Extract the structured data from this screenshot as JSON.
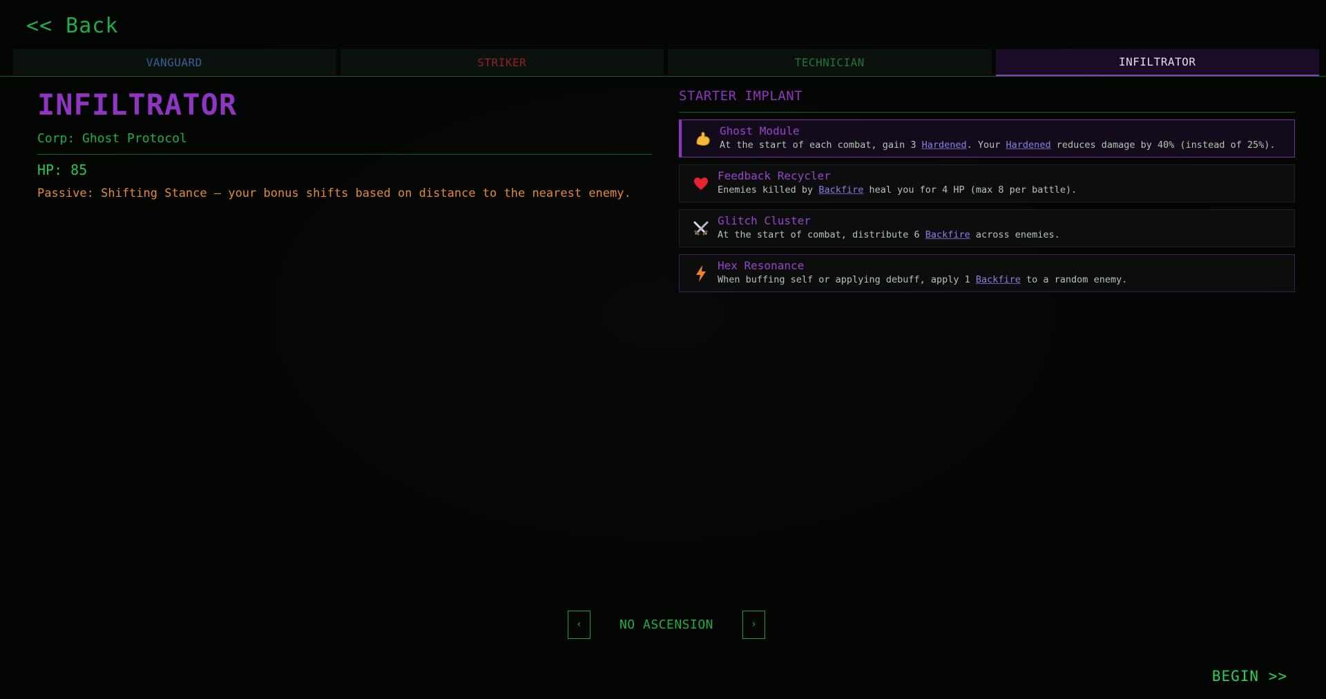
{
  "nav": {
    "back_label": "<< Back"
  },
  "tabs": [
    {
      "label": "VANGUARD",
      "active": false
    },
    {
      "label": "STRIKER",
      "active": false
    },
    {
      "label": "TECHNICIAN",
      "active": false
    },
    {
      "label": "INFILTRATOR",
      "active": true
    }
  ],
  "character": {
    "title": "INFILTRATOR",
    "corp": "Corp: Ghost Protocol",
    "hp": "HP: 85",
    "passive": "Passive: Shifting Stance — your bonus shifts based on distance to the nearest enemy."
  },
  "implants_section": {
    "title": "STARTER IMPLANT",
    "items": [
      {
        "name": "Ghost Module",
        "icon": "flexed-arm-icon",
        "selected": true,
        "desc_parts": [
          "At the start of each combat, gain 3 ",
          "Hardened",
          ". Your ",
          "Hardened",
          " reduces damage by 40% (instead of 25%)."
        ]
      },
      {
        "name": "Feedback Recycler",
        "icon": "heart-icon",
        "selected": false,
        "desc_parts": [
          "Enemies killed by ",
          "Backfire",
          " heal you for 4 HP (max 8 per battle)."
        ]
      },
      {
        "name": "Glitch Cluster",
        "icon": "crossed-swords-icon",
        "selected": false,
        "desc_parts": [
          "At the start of combat, distribute 6 ",
          "Backfire",
          " across enemies."
        ]
      },
      {
        "name": "Hex Resonance",
        "icon": "lightning-icon",
        "selected": false,
        "desc_parts": [
          "When buffing self or applying debuff, apply 1 ",
          "Backfire",
          " to a random enemy."
        ]
      }
    ]
  },
  "ascension": {
    "label": "NO ASCENSION",
    "prev": "‹",
    "next": "›"
  },
  "footer": {
    "begin_label": "BEGIN >>"
  },
  "colors": {
    "accent_green": "#1fae45",
    "infiltrator_purple": "#8e35c2",
    "passive_orange": "#e08a38",
    "keyword": "#8c7fe6"
  }
}
